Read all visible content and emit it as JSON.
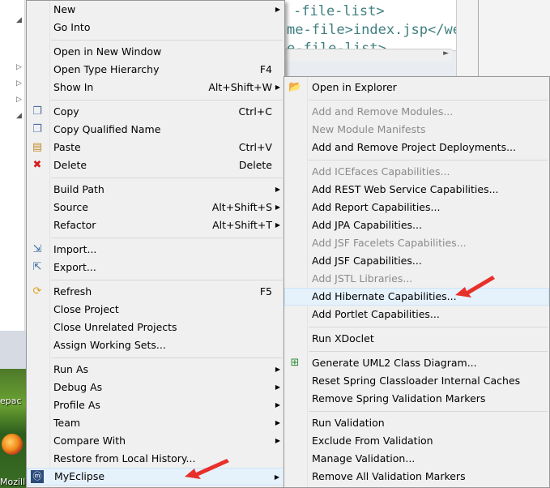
{
  "background": {
    "code_lines": [
      "-file-list>",
      "me-file>index.jsp</we",
      "e-file-list>"
    ],
    "desktop_labels": [
      "epac",
      "Mozill"
    ]
  },
  "context_menu": {
    "items": [
      {
        "label": "New",
        "submenu": true
      },
      {
        "label": "Go Into"
      },
      {
        "label": "Open in New Window"
      },
      {
        "label": "Open Type Hierarchy",
        "shortcut": "F4"
      },
      {
        "label": "Show In",
        "shortcut": "Alt+Shift+W",
        "submenu": true
      },
      {
        "label": "Copy",
        "shortcut": "Ctrl+C",
        "icon": "copy-icon"
      },
      {
        "label": "Copy Qualified Name",
        "icon": "copy-qualified-name-icon"
      },
      {
        "label": "Paste",
        "shortcut": "Ctrl+V",
        "icon": "paste-icon"
      },
      {
        "label": "Delete",
        "shortcut": "Delete",
        "icon": "delete-icon"
      },
      {
        "label": "Build Path",
        "submenu": true
      },
      {
        "label": "Source",
        "shortcut": "Alt+Shift+S",
        "submenu": true
      },
      {
        "label": "Refactor",
        "shortcut": "Alt+Shift+T",
        "submenu": true
      },
      {
        "label": "Import...",
        "icon": "import-icon"
      },
      {
        "label": "Export...",
        "icon": "export-icon"
      },
      {
        "label": "Refresh",
        "shortcut": "F5",
        "icon": "refresh-icon"
      },
      {
        "label": "Close Project"
      },
      {
        "label": "Close Unrelated Projects"
      },
      {
        "label": "Assign Working Sets..."
      },
      {
        "label": "Run As",
        "submenu": true
      },
      {
        "label": "Debug As",
        "submenu": true
      },
      {
        "label": "Profile As",
        "submenu": true
      },
      {
        "label": "Team",
        "submenu": true
      },
      {
        "label": "Compare With",
        "submenu": true
      },
      {
        "label": "Restore from Local History..."
      },
      {
        "label": "MyEclipse",
        "submenu": true,
        "icon": "myeclipse-icon",
        "highlighted": true
      }
    ]
  },
  "myeclipse_submenu": {
    "items": [
      {
        "label": "Open in Explorer",
        "icon": "folder-icon"
      },
      {
        "label": "Add and Remove Modules...",
        "disabled": true
      },
      {
        "label": "New Module Manifests",
        "disabled": true
      },
      {
        "label": "Add and Remove Project Deployments..."
      },
      {
        "label": "Add ICEfaces Capabilities...",
        "disabled": true
      },
      {
        "label": "Add REST Web Service Capabilities..."
      },
      {
        "label": "Add Report Capabilities..."
      },
      {
        "label": "Add JPA Capabilities..."
      },
      {
        "label": "Add JSF Facelets Capabilities...",
        "disabled": true
      },
      {
        "label": "Add JSF Capabilities..."
      },
      {
        "label": "Add JSTL Libraries...",
        "disabled": true
      },
      {
        "label": "Add Hibernate Capabilities...",
        "highlighted": true
      },
      {
        "label": "Add Portlet Capabilities..."
      },
      {
        "label": "Run XDoclet"
      },
      {
        "label": "Generate UML2 Class Diagram...",
        "icon": "uml-diagram-icon"
      },
      {
        "label": "Reset Spring Classloader Internal Caches"
      },
      {
        "label": "Remove Spring Validation Markers"
      },
      {
        "label": "Run Validation"
      },
      {
        "label": "Exclude From Validation"
      },
      {
        "label": "Manage Validation..."
      },
      {
        "label": "Remove All Validation Markers"
      }
    ]
  },
  "colors": {
    "menu_bg": "#f0f0f0",
    "highlight_bg": "#e5f1fb",
    "annotation_arrow": "#e8302b",
    "disabled_text": "#8a8a8a"
  }
}
